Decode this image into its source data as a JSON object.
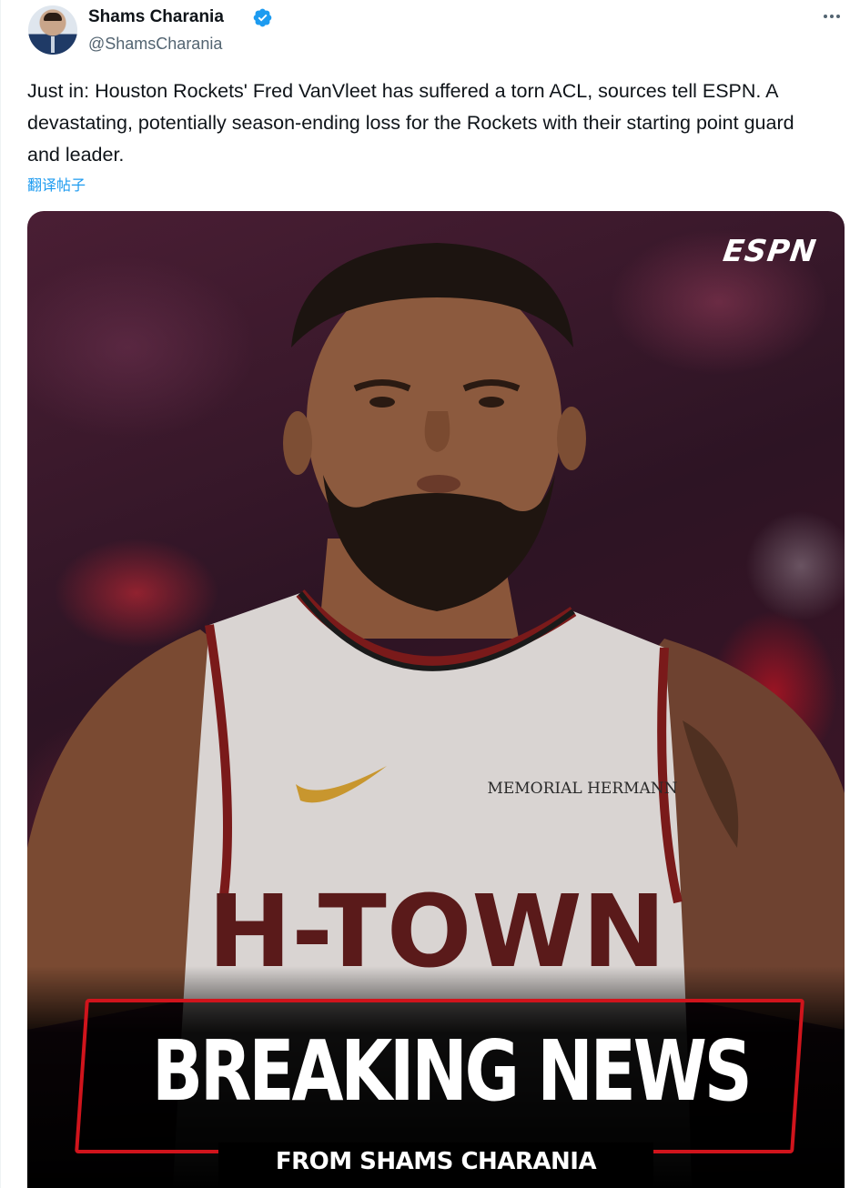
{
  "author": {
    "name": "Shams Charania",
    "handle": "@ShamsCharania",
    "verified_icon": "verified-badge-icon",
    "accent": "#1d9bf0"
  },
  "tweet": {
    "text": "Just in: Houston Rockets' Fred VanVleet has suffered a torn ACL, sources tell ESPN. A devastating, potentially season-ending loss for the Rockets with their starting point guard and leader.",
    "translate_label": "翻译帖子"
  },
  "media": {
    "brand": "ESPN",
    "jersey_sponsor": "MEMORIAL HERMANN",
    "jersey_text": "H-TOWN",
    "headline": "BREAKING NEWS",
    "subline": "FROM SHAMS CHARANIA",
    "accent": "#d0141c"
  },
  "menu": {
    "more_icon": "more-horizontal-icon"
  }
}
